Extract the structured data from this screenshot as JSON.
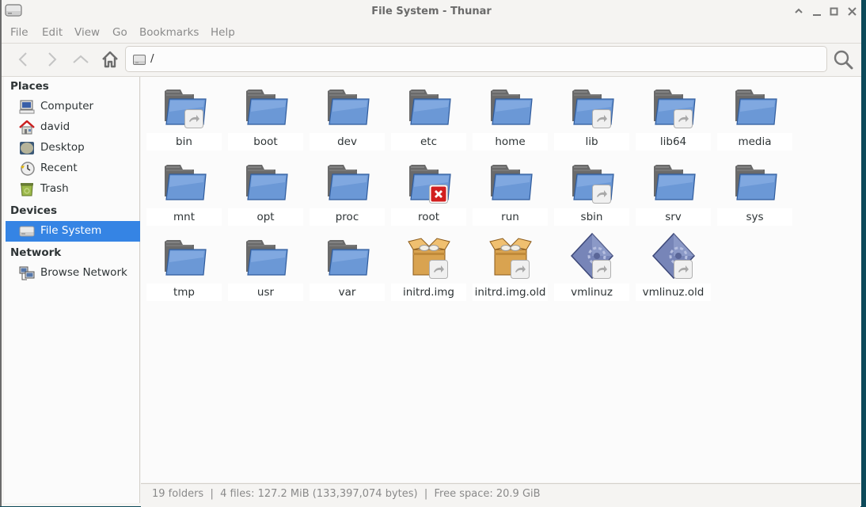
{
  "window": {
    "title": "File System - Thunar",
    "controls": [
      "shade",
      "minimize",
      "maximize",
      "close"
    ]
  },
  "menubar": {
    "items": [
      "File",
      "Edit",
      "View",
      "Go",
      "Bookmarks",
      "Help"
    ]
  },
  "toolbar": {
    "back_icon": "chevron-left-icon",
    "forward_icon": "chevron-right-icon",
    "up_icon": "chevron-up-icon",
    "home_icon": "home-icon",
    "location_path": "/",
    "search_icon": "search-icon"
  },
  "sidebar": {
    "sections": [
      {
        "title": "Places",
        "items": [
          {
            "label": "Computer",
            "icon": "computer-icon"
          },
          {
            "label": "david",
            "icon": "home-folder-icon"
          },
          {
            "label": "Desktop",
            "icon": "desktop-icon"
          },
          {
            "label": "Recent",
            "icon": "recent-clock-icon"
          },
          {
            "label": "Trash",
            "icon": "trash-icon"
          }
        ]
      },
      {
        "title": "Devices",
        "items": [
          {
            "label": "File System",
            "icon": "drive-icon",
            "selected": true
          }
        ]
      },
      {
        "title": "Network",
        "items": [
          {
            "label": "Browse Network",
            "icon": "network-icon"
          }
        ]
      }
    ]
  },
  "files": [
    {
      "name": "bin",
      "type": "folder",
      "emblem": "symlink"
    },
    {
      "name": "boot",
      "type": "folder"
    },
    {
      "name": "dev",
      "type": "folder"
    },
    {
      "name": "etc",
      "type": "folder"
    },
    {
      "name": "home",
      "type": "folder"
    },
    {
      "name": "lib",
      "type": "folder",
      "emblem": "symlink"
    },
    {
      "name": "lib64",
      "type": "folder",
      "emblem": "symlink"
    },
    {
      "name": "media",
      "type": "folder"
    },
    {
      "name": "mnt",
      "type": "folder"
    },
    {
      "name": "opt",
      "type": "folder"
    },
    {
      "name": "proc",
      "type": "folder"
    },
    {
      "name": "root",
      "type": "folder",
      "emblem": "unreadable"
    },
    {
      "name": "run",
      "type": "folder"
    },
    {
      "name": "sbin",
      "type": "folder",
      "emblem": "symlink"
    },
    {
      "name": "srv",
      "type": "folder"
    },
    {
      "name": "sys",
      "type": "folder"
    },
    {
      "name": "tmp",
      "type": "folder"
    },
    {
      "name": "usr",
      "type": "folder"
    },
    {
      "name": "var",
      "type": "folder"
    },
    {
      "name": "initrd.img",
      "type": "package",
      "emblem": "symlink"
    },
    {
      "name": "initrd.img.old",
      "type": "package",
      "emblem": "symlink"
    },
    {
      "name": "vmlinuz",
      "type": "executable",
      "emblem": "symlink"
    },
    {
      "name": "vmlinuz.old",
      "type": "executable",
      "emblem": "symlink"
    }
  ],
  "statusbar": {
    "text": "19 folders  |  4 files: 127.2 MiB (133,397,074 bytes)  |  Free space: 20.9 GiB"
  }
}
